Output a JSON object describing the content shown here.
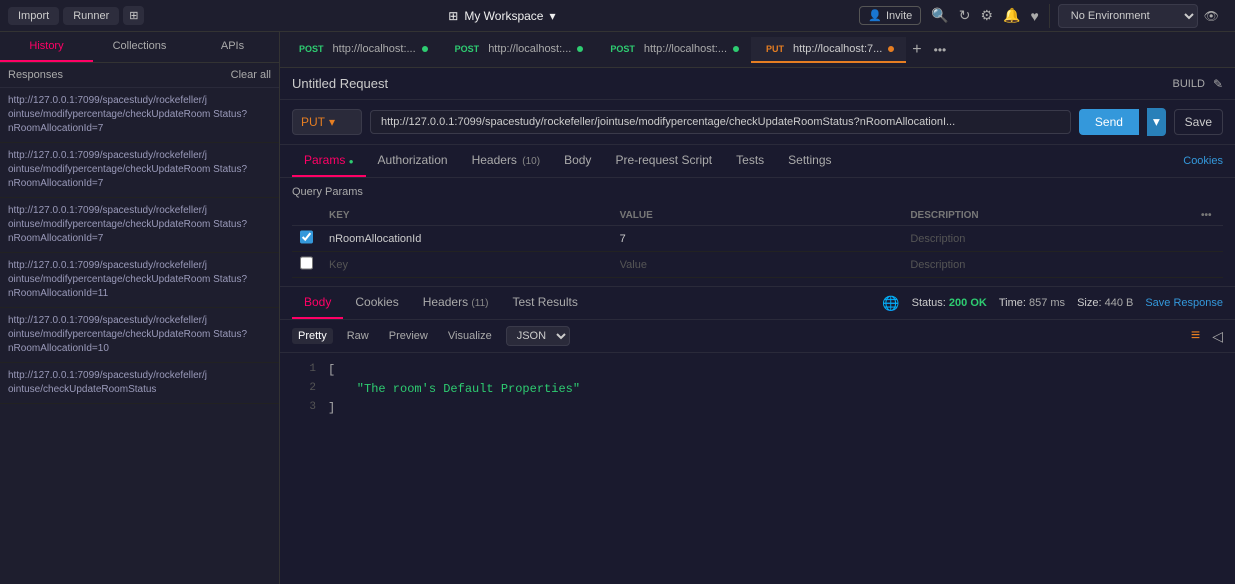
{
  "topbar": {
    "import_label": "Import",
    "runner_label": "Runner",
    "workspace_label": "My Workspace",
    "invite_label": "Invite"
  },
  "sidebar": {
    "search_placeholder": "Responses",
    "clear_all_label": "Clear all",
    "tabs": [
      {
        "label": "Collections",
        "active": true
      },
      {
        "label": "APIs",
        "active": false
      }
    ],
    "items": [
      {
        "url": "http://127.0.0.1:7099/spacestudy/rockefeller/jointuse/modifypercentage/checkUpdateRoomStatus?nRoomAllocationId=7"
      },
      {
        "url": "http://127.0.0.1:7099/spacestudy/rockefeller/jointuse/modifypercentage/checkUpdateRoomStatus?nRoomAllocationId=7"
      },
      {
        "url": "http://127.0.0.1:7099/spacestudy/rockefeller/jointuse/modifypercentage/checkUpdateRoomStatus?nRoomAllocationId=7"
      },
      {
        "url": "http://127.0.0.1:7099/spacestudy/rockefeller/jointuse/modifypercentage/checkUpdateRoomStatus?nRoomAllocationId=11"
      },
      {
        "url": "http://127.0.0.1:7099/spacestudy/rockefeller/jointuse/modifypercentage/checkUpdateRoomStatus?nRoomAllocationId=10"
      },
      {
        "url": "http://127.0.0.1:7099/spacestudy/rockefeller/jointuse/checkUpdateRoomStatus"
      }
    ]
  },
  "tabs": [
    {
      "method": "POST",
      "url": "http://localhost:...",
      "dot": "green",
      "active": false
    },
    {
      "method": "POST",
      "url": "http://localhost:...",
      "dot": "green",
      "active": false
    },
    {
      "method": "POST",
      "url": "http://localhost:...",
      "dot": "green",
      "active": false
    },
    {
      "method": "PUT",
      "url": "http://localhost:7...",
      "dot": "orange",
      "active": true
    }
  ],
  "request": {
    "title": "Untitled Request",
    "build_label": "BUILD",
    "method": "PUT",
    "url": "http://127.0.0.1:7099/spacestudy/rockefeller/jointuse/modifypercentage/checkUpdateRoomStatus?nRoomAllocationI...",
    "send_label": "Send",
    "save_label": "Save"
  },
  "request_tabs": [
    {
      "label": "Params",
      "count": "",
      "active": true,
      "dot": true
    },
    {
      "label": "Authorization",
      "count": "",
      "active": false
    },
    {
      "label": "Headers",
      "count": "10",
      "active": false
    },
    {
      "label": "Body",
      "count": "",
      "active": false
    },
    {
      "label": "Pre-request Script",
      "count": "",
      "active": false
    },
    {
      "label": "Tests",
      "count": "",
      "active": false
    },
    {
      "label": "Settings",
      "count": "",
      "active": false
    }
  ],
  "cookies_label": "Cookies",
  "query_params": {
    "title": "Query Params",
    "columns": [
      {
        "label": "KEY"
      },
      {
        "label": "VALUE"
      },
      {
        "label": "DESCRIPTION"
      }
    ],
    "rows": [
      {
        "checked": true,
        "key": "nRoomAllocationId",
        "value": "7",
        "description": ""
      },
      {
        "checked": false,
        "key": "",
        "value": "",
        "description": ""
      }
    ],
    "key_placeholder": "Key",
    "value_placeholder": "Value",
    "description_placeholder": "Description"
  },
  "response": {
    "tabs": [
      {
        "label": "Body",
        "active": true
      },
      {
        "label": "Cookies",
        "active": false
      },
      {
        "label": "Headers",
        "count": "11",
        "active": false
      },
      {
        "label": "Test Results",
        "active": false
      }
    ],
    "status": "200 OK",
    "time": "857 ms",
    "size": "440 B",
    "save_label": "Save Response",
    "views": [
      {
        "label": "Pretty",
        "active": true
      },
      {
        "label": "Raw",
        "active": false
      },
      {
        "label": "Preview",
        "active": false
      },
      {
        "label": "Visualize",
        "active": false
      }
    ],
    "format": "JSON",
    "code": [
      {
        "line": 1,
        "content": "["
      },
      {
        "line": 2,
        "content": "  \"The room's Default Properties\""
      },
      {
        "line": 3,
        "content": "]"
      }
    ]
  },
  "environment": {
    "label": "No Environment"
  }
}
